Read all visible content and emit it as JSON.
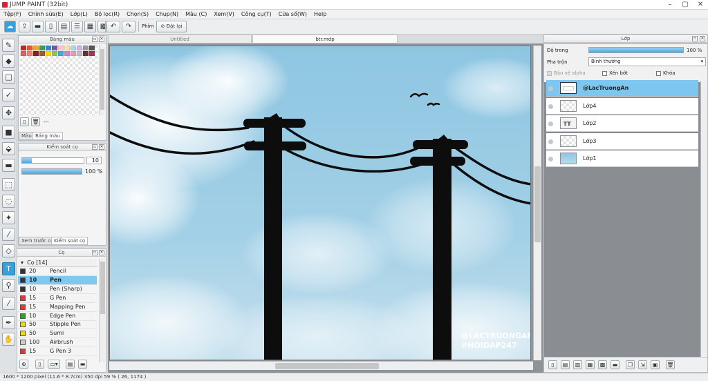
{
  "window": {
    "title": "JUMP PAINT (32bit)"
  },
  "menu": [
    "Tệp(F)",
    "Chỉnh sửa(E)",
    "Lớp(L)",
    "Bộ lọc(R)",
    "Chọn(S)",
    "Chụp(N)",
    "Màu (C)",
    "Xem(V)",
    "Công cụ(T)",
    "Cửa sổ(W)",
    "Help"
  ],
  "toolbar": {
    "phim_label": "Phím",
    "reset_label": "Đặt lại"
  },
  "color_panel": {
    "title": "Bảng màu",
    "dash": "---",
    "tabs": [
      "Màu",
      "Bảng màu"
    ]
  },
  "swatch_colors": [
    "#cc2222",
    "#ee5522",
    "#f5a623",
    "#3aa050",
    "#3388cc",
    "#7755aa",
    "#ffc2d0",
    "#ffe0a0",
    "#a8d8f0",
    "#d8b0e8",
    "#9a9a9a",
    "#555555",
    "#e06060",
    "#f08080",
    "#882222",
    "#aa5533",
    "#ffd700",
    "#88cc44",
    "#44aadd",
    "#cc88cc",
    "#e0a0b0",
    "#c0c0c0",
    "#663333",
    "#aa3355"
  ],
  "brush_control": {
    "title": "Kiểm soát cọ",
    "size": "10",
    "opacity": "100 %",
    "tabs": [
      "Xem trước cọ",
      "Kiểm soát cọ"
    ]
  },
  "brush_panel": {
    "title": "Cọ",
    "group": "Cọ [14]",
    "items": [
      {
        "size": "20",
        "name": "Pencil",
        "color": "#333333"
      },
      {
        "size": "10",
        "name": "Pen",
        "color": "#333333"
      },
      {
        "size": "10",
        "name": "Pen (Sharp)",
        "color": "#333333"
      },
      {
        "size": "15",
        "name": "G Pen",
        "color": "#ee3333"
      },
      {
        "size": "15",
        "name": "Mapping Pen",
        "color": "#ee3333"
      },
      {
        "size": "10",
        "name": "Edge Pen",
        "color": "#22aa22"
      },
      {
        "size": "50",
        "name": "Stipple Pen",
        "color": "#eedd00"
      },
      {
        "size": "50",
        "name": "Sumi",
        "color": "#eedd00"
      },
      {
        "size": "100",
        "name": "Airbrush",
        "color": "#cccccc"
      },
      {
        "size": "15",
        "name": "G Pen 3",
        "color": "#ee3333"
      }
    ]
  },
  "doc_tabs": [
    "Untitled",
    "btr.mdp"
  ],
  "canvas": {
    "watermark_1": "@LACTRUONGAN",
    "watermark_2": "#HOIDAP247"
  },
  "layer_panel": {
    "title": "Lớp",
    "opacity_label": "Độ trong",
    "opacity_value": "100 %",
    "blend_label": "Pha trộn",
    "blend_value": "Bình thường",
    "protect_alpha": "Bảo vệ alpha",
    "clipping": "Xén bớt",
    "lock": "Khóa",
    "layers": [
      "@LacTruongAn",
      "Lớp4",
      "Lớp2",
      "Lớp3",
      "Lớp1"
    ]
  },
  "status": {
    "text": "1600 * 1200 pixel   (11.6 * 8.7cm)  350 dpi   59 %   ( 26, 1174 )"
  }
}
